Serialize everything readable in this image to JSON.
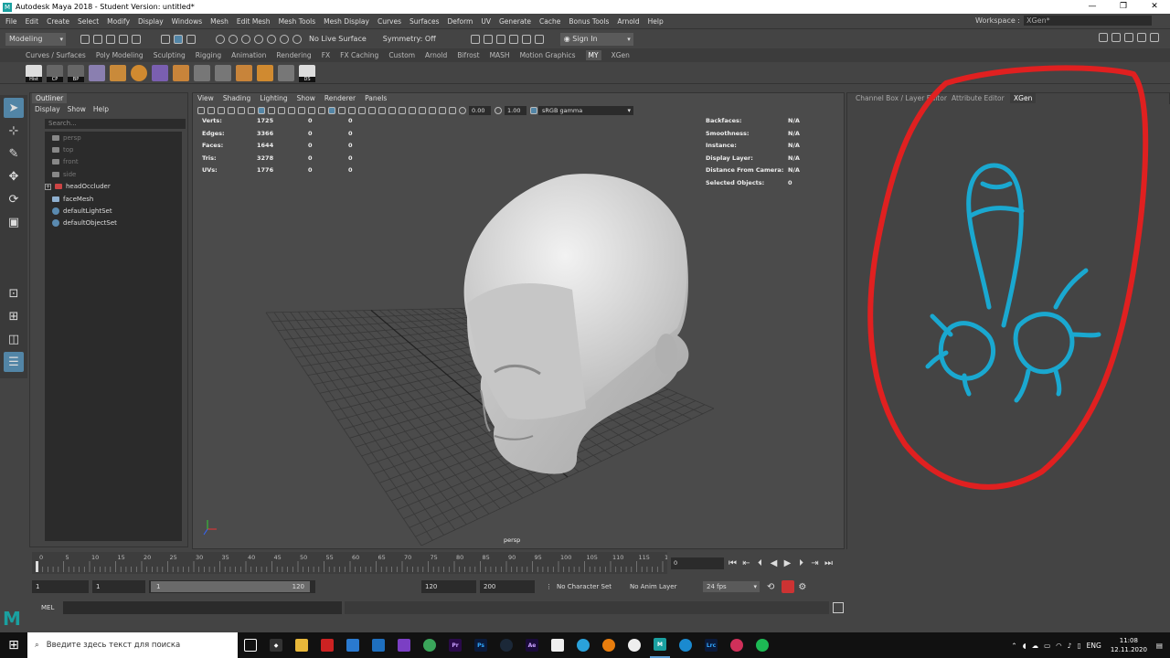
{
  "window": {
    "title": "Autodesk Maya 2018 - Student Version: untitled*",
    "controls": [
      "—",
      "❐",
      "✕"
    ]
  },
  "menubar": {
    "items": [
      "File",
      "Edit",
      "Create",
      "Select",
      "Modify",
      "Display",
      "Windows",
      "Mesh",
      "Edit Mesh",
      "Mesh Tools",
      "Mesh Display",
      "Curves",
      "Surfaces",
      "Deform",
      "UV",
      "Generate",
      "Cache",
      "Bonus Tools",
      "Arnold",
      "Help"
    ],
    "workspace_label": "Workspace :",
    "workspace_value": "XGen*"
  },
  "statusline": {
    "mode": "Modeling",
    "live_surface": "No Live Surface",
    "symmetry": "Symmetry: Off",
    "sign_in": "Sign In"
  },
  "shelf": {
    "tabs": [
      "Curves / Surfaces",
      "Poly Modeling",
      "Sculpting",
      "Rigging",
      "Animation",
      "Rendering",
      "FX",
      "FX Caching",
      "Custom",
      "Arnold",
      "Bifrost",
      "MASH",
      "Motion Graphics",
      "MY",
      "XGen"
    ],
    "active_tab": "MY",
    "icon_labels": [
      "Hist",
      "CP",
      "BP",
      "",
      "",
      "",
      "",
      "",
      "",
      "",
      "",
      "",
      "",
      "DS"
    ]
  },
  "outliner": {
    "title": "Outliner",
    "menu": [
      "Display",
      "Show",
      "Help"
    ],
    "search_placeholder": "Search...",
    "items": [
      {
        "label": "persp",
        "dim": true
      },
      {
        "label": "top",
        "dim": true
      },
      {
        "label": "front",
        "dim": true
      },
      {
        "label": "side",
        "dim": true
      },
      {
        "label": "headOccluder",
        "dim": false
      },
      {
        "label": "faceMesh",
        "dim": false
      },
      {
        "label": "defaultLightSet",
        "dim": false
      },
      {
        "label": "defaultObjectSet",
        "dim": false
      }
    ]
  },
  "viewport": {
    "menu": [
      "View",
      "Shading",
      "Lighting",
      "Show",
      "Renderer",
      "Panels"
    ],
    "near_value": "0.00",
    "far_value": "1.00",
    "color_space": "sRGB gamma",
    "camera_label": "persp",
    "stats": [
      {
        "label": "Verts:",
        "v1": "1725",
        "v2": "0",
        "v3": "0"
      },
      {
        "label": "Edges:",
        "v1": "3366",
        "v2": "0",
        "v3": "0"
      },
      {
        "label": "Faces:",
        "v1": "1644",
        "v2": "0",
        "v3": "0"
      },
      {
        "label": "Tris:",
        "v1": "3278",
        "v2": "0",
        "v3": "0"
      },
      {
        "label": "UVs:",
        "v1": "1776",
        "v2": "0",
        "v3": "0"
      }
    ],
    "info": [
      {
        "label": "Backfaces:",
        "value": "N/A"
      },
      {
        "label": "Smoothness:",
        "value": "N/A"
      },
      {
        "label": "Instance:",
        "value": "N/A"
      },
      {
        "label": "Display Layer:",
        "value": "N/A"
      },
      {
        "label": "Distance From Camera:",
        "value": "N/A"
      },
      {
        "label": "Selected Objects:",
        "value": "0"
      }
    ]
  },
  "rightpanel": {
    "tabs": [
      "Channel Box / Layer Editor",
      "Attribute Editor",
      "XGen"
    ],
    "active_tab": "XGen",
    "annotation_colors": {
      "circle": "#e02020",
      "doodle": "#1aa8d0"
    }
  },
  "timeline": {
    "ticks": [
      "0",
      "5",
      "10",
      "15",
      "20",
      "25",
      "30",
      "35",
      "40",
      "45",
      "50",
      "55",
      "60",
      "65",
      "70",
      "75",
      "80",
      "85",
      "90",
      "95",
      "100",
      "105",
      "110",
      "115",
      "12"
    ],
    "current_frame": "0",
    "range_start": "1",
    "range_start2": "1",
    "range_slider_start": "1",
    "range_slider_end": "120",
    "range_end": "120",
    "anim_end": "200",
    "character_set": "No Character Set",
    "anim_layer": "No Anim Layer",
    "fps": "24 fps"
  },
  "mel": {
    "label": "MEL"
  },
  "taskbar": {
    "search_placeholder": "Введите здесь текст для поиска",
    "language": "ENG",
    "time": "11:08",
    "date": "12.11.2020"
  }
}
